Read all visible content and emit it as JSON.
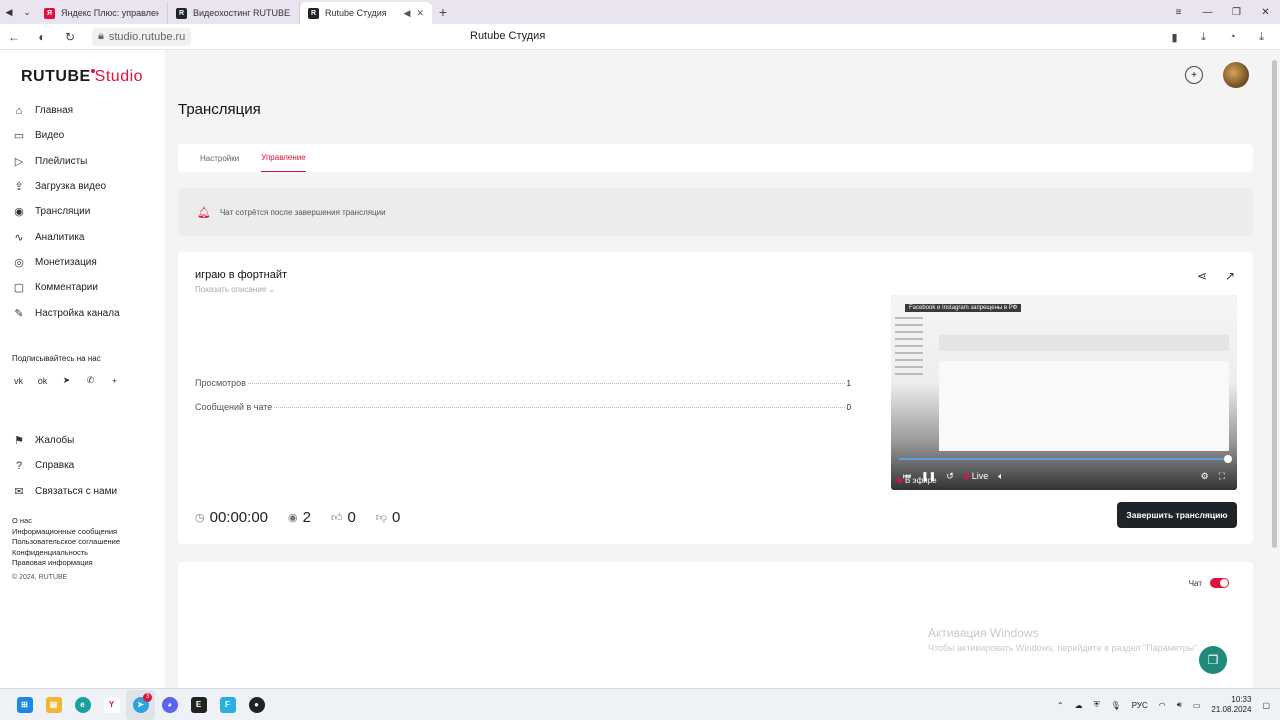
{
  "browser": {
    "tabs": [
      {
        "label": "Яндекс Плюс: управлени",
        "favicon_color": "#e0103f"
      },
      {
        "label": "Видеохостинг RUTUBE. С",
        "favicon_color": "#1f2428"
      },
      {
        "label": "Rutube Студия",
        "favicon_color": "#1f2428",
        "active": true
      }
    ],
    "url": "studio.rutube.ru",
    "page_title": "Rutube Студия"
  },
  "logo": {
    "brand": "RUTUBE",
    "product": "Studio"
  },
  "sidebar": {
    "items": [
      {
        "label": "Главная",
        "icon": "home-icon",
        "glyph": "⌂"
      },
      {
        "label": "Видео",
        "icon": "video-icon",
        "glyph": "▭"
      },
      {
        "label": "Плейлисты",
        "icon": "playlist-icon",
        "glyph": "▷"
      },
      {
        "label": "Загрузка видео",
        "icon": "upload-icon",
        "glyph": "⇪"
      },
      {
        "label": "Трансляции",
        "icon": "broadcast-icon",
        "glyph": "◉"
      },
      {
        "label": "Аналитика",
        "icon": "analytics-icon",
        "glyph": "∿"
      },
      {
        "label": "Монетизация",
        "icon": "monetization-icon",
        "glyph": "◎"
      },
      {
        "label": "Комментарии",
        "icon": "comments-icon",
        "glyph": "▢"
      },
      {
        "label": "Настройка канала",
        "icon": "settings-icon",
        "glyph": "✎"
      }
    ],
    "follow_label": "Подписывайтесь на нас",
    "socials": [
      {
        "icon": "vk-icon",
        "glyph": "vk"
      },
      {
        "icon": "ok-icon",
        "glyph": "ok"
      },
      {
        "icon": "telegram-icon",
        "glyph": "➤"
      },
      {
        "icon": "viber-icon",
        "glyph": "✆"
      },
      {
        "icon": "more-icon",
        "glyph": "+"
      }
    ],
    "secondary_items": [
      {
        "label": "Жалобы",
        "icon": "flag-icon",
        "glyph": "⚑"
      },
      {
        "label": "Справка",
        "icon": "help-icon",
        "glyph": "?"
      },
      {
        "label": "Связаться с нами",
        "icon": "contact-icon",
        "glyph": "✉"
      }
    ],
    "footer_links": [
      "О нас",
      "Информационные сообщения",
      "Пользовательское соглашение",
      "Конфиденциальность",
      "Правовая информация"
    ],
    "copyright": "© 2024, RUTUBE"
  },
  "main": {
    "title": "Трансляция",
    "tabs": [
      {
        "label": "Настройки"
      },
      {
        "label": "Управление",
        "active": true
      }
    ],
    "notice": "Чат сотрётся после завершения трансляции",
    "stream": {
      "title": "играю в фортнайт",
      "show_description": "Показать описание",
      "stats": [
        {
          "label": "Просмотров",
          "value": "1"
        },
        {
          "label": "Сообщений в чате",
          "value": "0"
        }
      ],
      "duration": "00:00:00",
      "viewers": "2",
      "likes": "0",
      "dislikes": "0",
      "player": {
        "banner": "Facebook и Instagram запрещены в РФ",
        "live_label": "Live",
        "on_air": "В эфире",
        "progress": 1.0
      },
      "finish_button": "Завершить трансляцию"
    },
    "chat": {
      "label": "Чат",
      "enabled": true
    },
    "watermark": {
      "line1": "Активация Windows",
      "line2": "Чтобы активировать Windows, перейдите в раздел \"Параметры\"."
    }
  },
  "taskbar": {
    "language": "РУС",
    "time": "10:33",
    "date": "21.08.2024",
    "telegram_badge": "3"
  },
  "colors": {
    "accent": "#e0103f",
    "dark_button": "#1f2428",
    "fab": "#1f8a7a"
  }
}
